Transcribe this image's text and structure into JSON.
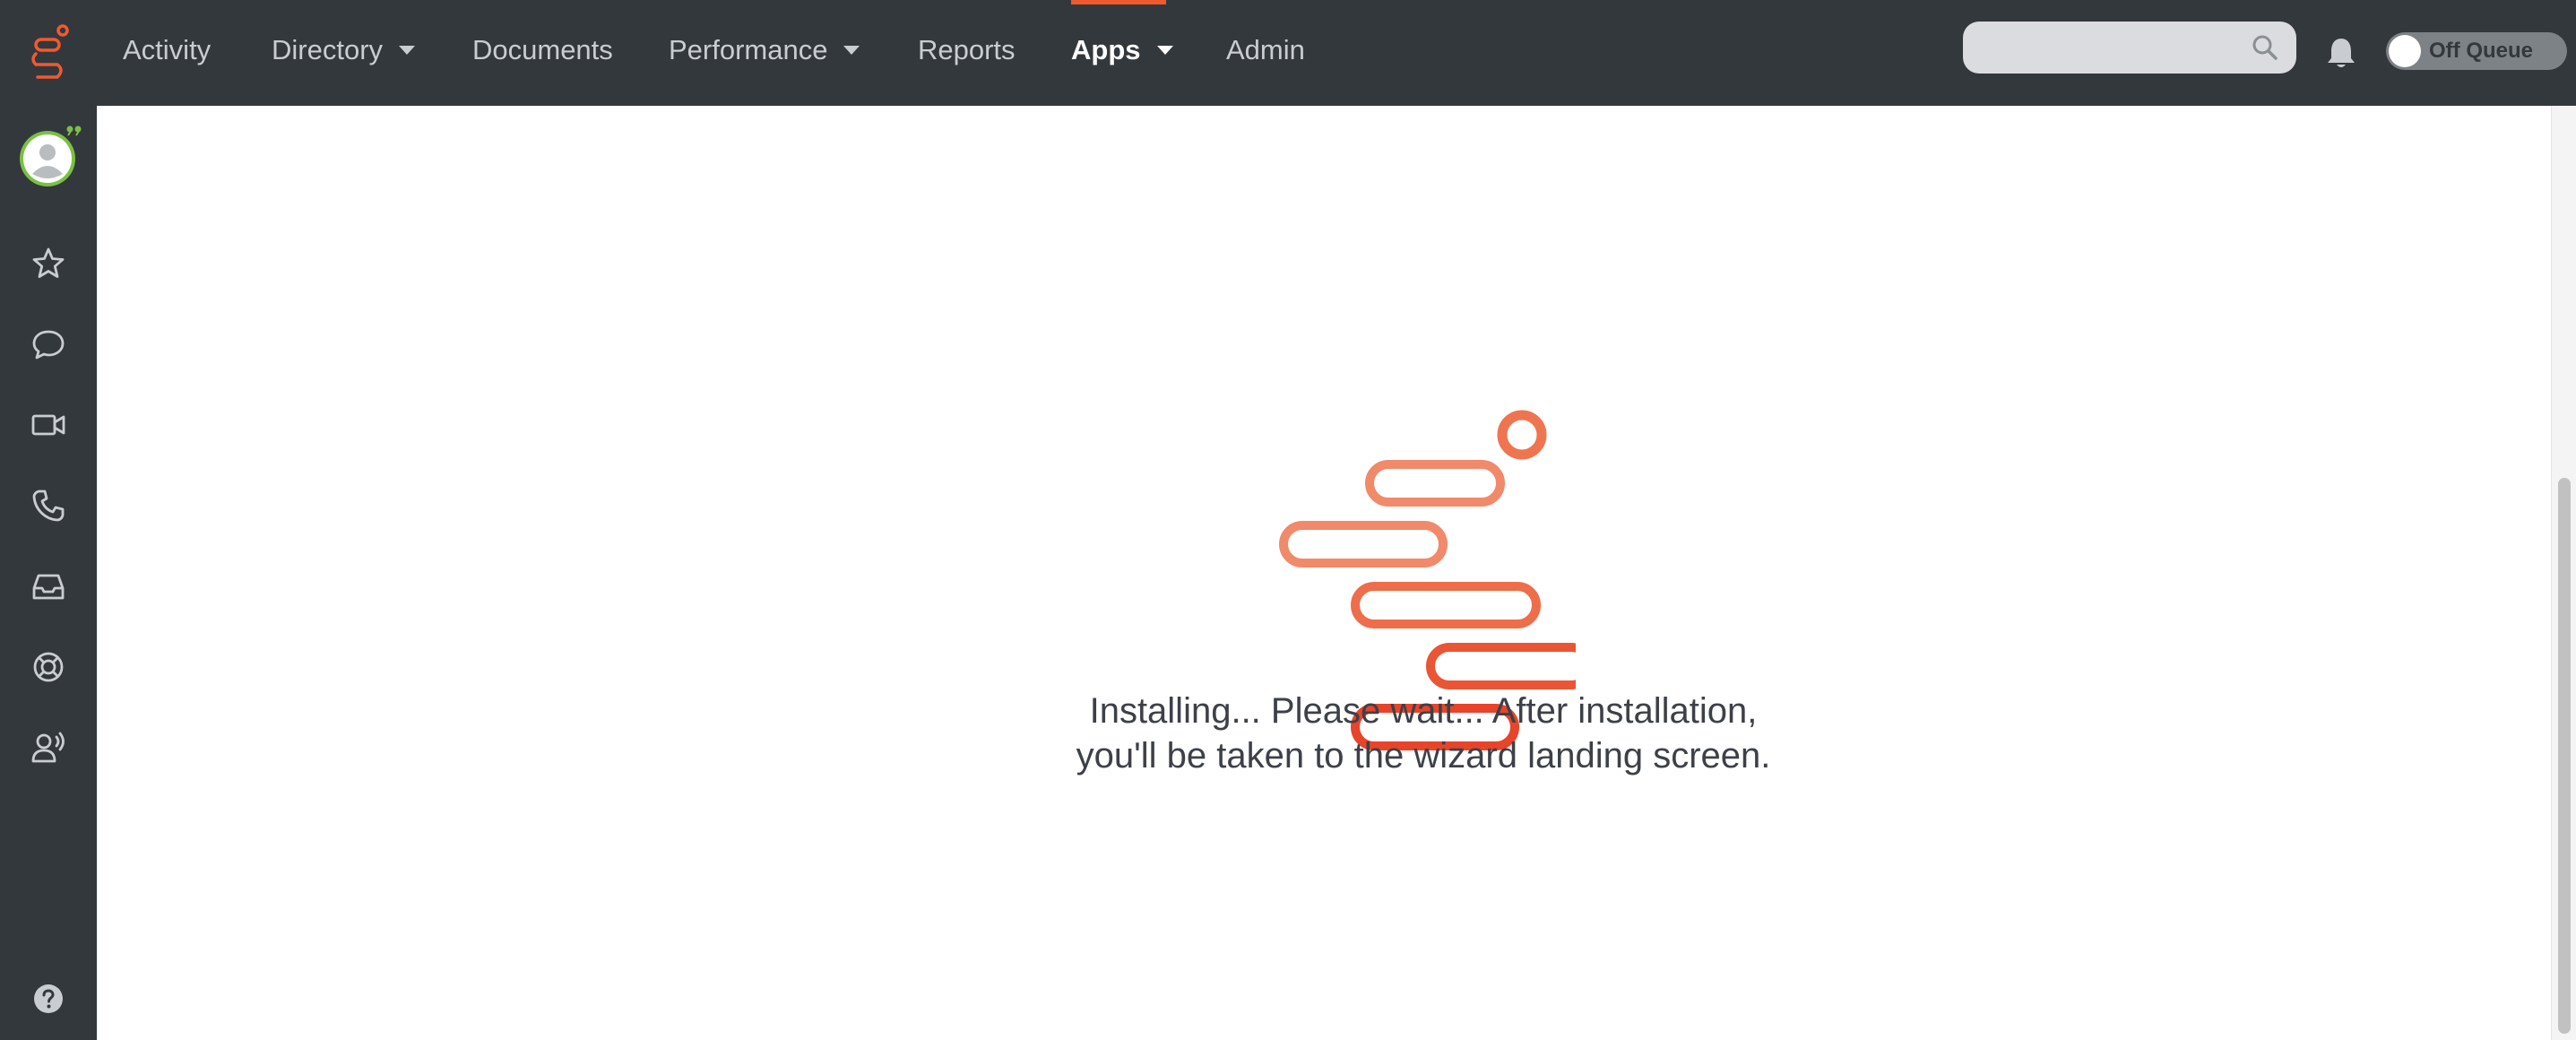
{
  "nav": {
    "items": [
      {
        "label": "Activity",
        "has_menu": false,
        "active": false
      },
      {
        "label": "Directory",
        "has_menu": true,
        "active": false
      },
      {
        "label": "Documents",
        "has_menu": false,
        "active": false
      },
      {
        "label": "Performance",
        "has_menu": true,
        "active": false
      },
      {
        "label": "Reports",
        "has_menu": false,
        "active": false
      },
      {
        "label": "Apps",
        "has_menu": true,
        "active": true
      },
      {
        "label": "Admin",
        "has_menu": false,
        "active": false
      }
    ]
  },
  "search": {
    "value": "",
    "placeholder": ""
  },
  "queue": {
    "label": "Off Queue",
    "on": false
  },
  "sidebar": {
    "icons": [
      "avatar",
      "star-icon",
      "chat-icon",
      "video-icon",
      "phone-icon",
      "inbox-icon",
      "support-icon",
      "agent-voice-icon",
      "help-icon"
    ]
  },
  "main": {
    "message_line1": "Installing... Please wait... After installation,",
    "message_line2": "you'll be taken to the wizard landing screen."
  },
  "colors": {
    "nav_bg": "#33383d",
    "accent": "#f05a2f",
    "spinner_light": "#f08a6a",
    "spinner_dark": "#e8442a",
    "avatar_green": "#7ac142"
  }
}
